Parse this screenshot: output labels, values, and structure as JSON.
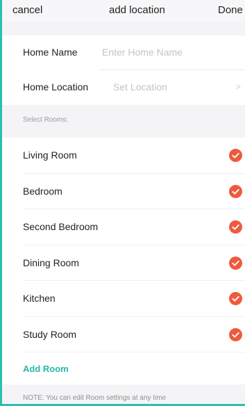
{
  "nav": {
    "cancel_label": "cancel",
    "title": "add location",
    "done_label": "Done"
  },
  "form": {
    "home_name_label": "Home Name",
    "home_name_placeholder": "Enter Home Name",
    "home_location_label": "Home Location",
    "home_location_placeholder": "Set Location",
    "chevron": ">"
  },
  "rooms": {
    "section_label": "Select Rooms:",
    "items": [
      {
        "name": "Living Room",
        "selected": true
      },
      {
        "name": "Bedroom",
        "selected": true
      },
      {
        "name": "Second Bedroom",
        "selected": true
      },
      {
        "name": "Dining Room",
        "selected": true
      },
      {
        "name": "Kitchen",
        "selected": true
      },
      {
        "name": "Study Room",
        "selected": true
      }
    ],
    "add_label": "Add Room",
    "note": "NOTE: You can edit Room settings at any time"
  },
  "colors": {
    "accent": "#26b9a6",
    "check": "#ef5a3c",
    "border": "#2bbfad"
  },
  "icons": {
    "check": "check-circle-icon",
    "chevron": "chevron-right-icon"
  }
}
